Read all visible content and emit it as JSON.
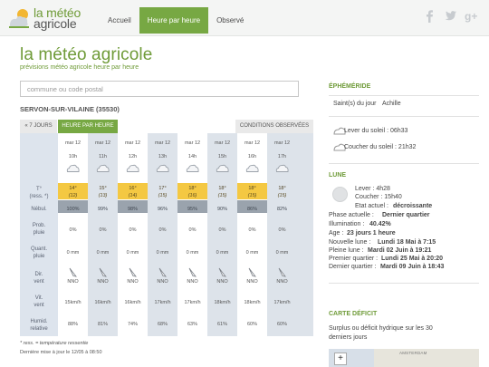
{
  "header": {
    "logo_line1": "la météo",
    "logo_line2": "agricole",
    "nav": [
      {
        "label": "Accueil"
      },
      {
        "label": "Heure par heure"
      },
      {
        "label": "Observé"
      }
    ],
    "social": [
      "facebook-icon",
      "twitter-icon",
      "google-plus-icon"
    ]
  },
  "page": {
    "title": "la météo agricole",
    "subtitle": "prévisions météo agricole heure par heure"
  },
  "search": {
    "placeholder": "commune ou code postal",
    "value": ""
  },
  "location": "SERVON-SUR-VILAINE (35530)",
  "tabs": {
    "seven_days": "« 7 JOURS",
    "hourly": "HEURE PAR HEURE",
    "observed": "CONDITIONS OBSERVÉES"
  },
  "labels": {
    "temp1": "T°",
    "temp2": "(ress. *)",
    "nebul": "Nébul.",
    "prob1": "Prob.",
    "prob2": "pluie",
    "quant1": "Quant.",
    "quant2": "pluie",
    "dir1": "Dir.",
    "dir2": "vent",
    "vit1": "Vit.",
    "vit2": "vent",
    "hum1": "Humid.",
    "hum2": "relative"
  },
  "hours": [
    {
      "date": "mar 12",
      "hour": "10h",
      "temp": "14°",
      "feels": "(12)",
      "nebul": "100%",
      "rain_prob": "0%",
      "rain_qty": "0 mm",
      "wind_dir": "NNO",
      "wind_speed": "15km/h",
      "humidity": "88%"
    },
    {
      "date": "mar 12",
      "hour": "11h",
      "temp": "15°",
      "feels": "(13)",
      "nebul": "99%",
      "rain_prob": "0%",
      "rain_qty": "0 mm",
      "wind_dir": "NNO",
      "wind_speed": "16km/h",
      "humidity": "81%"
    },
    {
      "date": "mar 12",
      "hour": "12h",
      "temp": "16°",
      "feels": "(14)",
      "nebul": "98%",
      "rain_prob": "0%",
      "rain_qty": "0 mm",
      "wind_dir": "NNO",
      "wind_speed": "16km/h",
      "humidity": "74%"
    },
    {
      "date": "mar 12",
      "hour": "13h",
      "temp": "17°",
      "feels": "(15)",
      "nebul": "96%",
      "rain_prob": "0%",
      "rain_qty": "0 mm",
      "wind_dir": "NNO",
      "wind_speed": "17km/h",
      "humidity": "68%"
    },
    {
      "date": "mar 12",
      "hour": "14h",
      "temp": "18°",
      "feels": "(16)",
      "nebul": "95%",
      "rain_prob": "0%",
      "rain_qty": "0 mm",
      "wind_dir": "NNO",
      "wind_speed": "17km/h",
      "humidity": "63%"
    },
    {
      "date": "mar 12",
      "hour": "15h",
      "temp": "18°",
      "feels": "(15)",
      "nebul": "90%",
      "rain_prob": "0%",
      "rain_qty": "0 mm",
      "wind_dir": "NNO",
      "wind_speed": "18km/h",
      "humidity": "61%"
    },
    {
      "date": "mar 12",
      "hour": "16h",
      "temp": "18°",
      "feels": "(15)",
      "nebul": "86%",
      "rain_prob": "0%",
      "rain_qty": "0 mm",
      "wind_dir": "NNO",
      "wind_speed": "18km/h",
      "humidity": "60%"
    },
    {
      "date": "mar 12",
      "hour": "17h",
      "temp": "18°",
      "feels": "(15)",
      "nebul": "82%",
      "rain_prob": "0%",
      "rain_qty": "0 mm",
      "wind_dir": "NNO",
      "wind_speed": "17km/h",
      "humidity": "60%"
    }
  ],
  "footnote": "* ress. = température ressentie",
  "updated": "Dernière mise à jour le 12/05 à 08:50",
  "ephemeride": {
    "title": "ÉPHÉMÉRIDE",
    "saint_label": "Saint(s) du jour",
    "saint_value": "Achille",
    "sunrise": "Lever du soleil : 06h33",
    "sunset": "Coucher du soleil : 21h32"
  },
  "moon": {
    "title": "LUNE",
    "rise": "Lever : 4h28",
    "set": "Coucher : 15h40",
    "state_label": "Etat actuel :",
    "state_value": "décroissante",
    "phase_label": "Phase actuelle :",
    "phase_value": "Dernier quartier",
    "illum_label": "Illumination :",
    "illum_value": "40.42%",
    "age_label": "Age :",
    "age_value": "23 jours 1 heure",
    "new_label": "Nouvelle lune :",
    "new_value": "Lundi 18 Mai à 7:15",
    "full_label": "Pleine lune :",
    "full_value": "Mardi 02 Juin à 19:21",
    "first_label": "Premier quartier :",
    "first_value": "Lundi 25 Mai à 20:20",
    "last_label": "Dernier quartier :",
    "last_value": "Mardi 09 Juin à 18:43"
  },
  "deficit": {
    "title": "CARTE DÉFICIT",
    "text1": "Surplus ou déficit hydrique sur les 30",
    "text2": "derniers jours",
    "map_label": "AMSTERDAM",
    "zoom_in": "+"
  },
  "colors": {
    "brand_green": "#77a843",
    "temp_band": "#f4c842",
    "nebul_band": "#9aa3ad"
  }
}
